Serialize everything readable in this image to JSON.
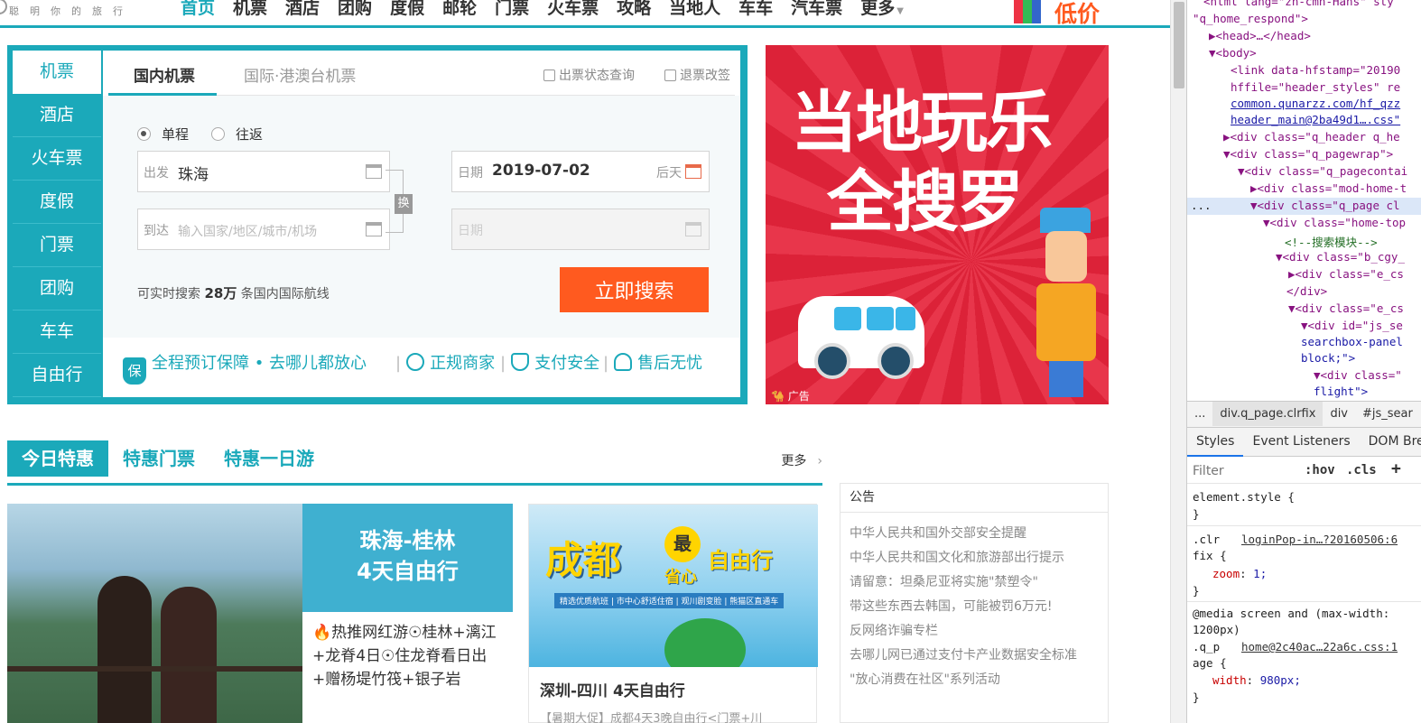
{
  "header": {
    "logo_tagline": "聪明你的旅行",
    "nav": [
      {
        "label": "首页",
        "active": true
      },
      {
        "label": "机票"
      },
      {
        "label": "酒店"
      },
      {
        "label": "团购"
      },
      {
        "label": "度假"
      },
      {
        "label": "邮轮"
      },
      {
        "label": "门票"
      },
      {
        "label": "火车票"
      },
      {
        "label": "攻略"
      },
      {
        "label": "当地人"
      },
      {
        "label": "车车"
      },
      {
        "label": "汽车票"
      },
      {
        "label": "更多"
      }
    ],
    "promo": "低价"
  },
  "search": {
    "categories": [
      "机票",
      "酒店",
      "火车票",
      "度假",
      "门票",
      "团购",
      "车车",
      "自由行"
    ],
    "tabs": [
      "国内机票",
      "国际·港澳台机票"
    ],
    "links": [
      "出票状态查询",
      "退票改签"
    ],
    "trip_types": [
      "单程",
      "往返"
    ],
    "from_label": "出发",
    "from_value": "珠海",
    "to_label": "到达",
    "to_placeholder": "输入国家/地区/城市/机场",
    "swap": "换",
    "date_label": "日期",
    "date_value": "2019-07-02",
    "date_hint": "后天",
    "return_label": "日期",
    "count_prefix": "可实时搜索",
    "count_num": "28万",
    "count_suffix": "条国内国际航线",
    "button": "立即搜索",
    "guarantees": [
      "全程预订保障 • 去哪儿都放心",
      "正规商家",
      "支付安全",
      "售后无忧"
    ],
    "shield_glyph": "保"
  },
  "ad": {
    "line1": "当地玩乐",
    "line2": "全搜罗",
    "tag": "广告"
  },
  "deals": {
    "tabs": [
      "今日特惠",
      "特惠门票",
      "特惠一日游"
    ],
    "more": "更多",
    "card1": {
      "title_line1": "珠海-桂林",
      "title_line2": "4天自由行",
      "desc": "🔥热推网红游☉桂林+漓江+龙脊4日☉住龙脊看日出+赠杨堤竹筏+银子岩"
    },
    "card2": {
      "banner_main": "成都",
      "banner_badge": "最",
      "banner_sub": "省心",
      "banner_free": "自由行",
      "banner_strip": "精选优质航班 | 市中心舒适住宿 | 观川剧变脸 | 熊猫区直通车",
      "title": "深圳-四川 4天自由行",
      "subtitle": "【暑期大促】成都4天3晚自由行<门票+川"
    }
  },
  "notice": {
    "title": "公告",
    "items": [
      "中华人民共和国外交部安全提醒",
      "中华人民共和国文化和旅游部出行提示",
      "请留意：坦桑尼亚将实施\"禁塑令\"",
      "带这些东西去韩国，可能被罚6万元!",
      "反网络诈骗专栏",
      "去哪儿网已通过支付卡产业数据安全标准",
      "\"放心消费在社区\"系列活动"
    ]
  },
  "devtools": {
    "dom_lines": [
      "<html lang=\"zh-cmn-Hans\" sty",
      "\"q_home_respond\">",
      "▶<head>…</head>",
      "▼<body>",
      "<link data-hfstamp=\"20190",
      "hffile=\"header_styles\" re",
      "common.qunarzz.com/hf_qzz",
      "header_main@2ba49d1….css\"",
      "▶<div class=\"q_header q_he",
      "▼<div class=\"q_pagewrap\">",
      "▼<div class=\"q_pagecontai",
      "▶<div class=\"mod-home-t",
      "▼<div class=\"q_page cl",
      "▼<div class=\"home-top",
      "<!--搜索模块-->",
      "▼<div class=\"b_cgy_",
      "▶<div class=\"e_cs",
      "</div>",
      "▼<div class=\"e_cs",
      "▼<div id=\"js_se",
      "searchbox-panel",
      "block;\">",
      "▼<div class=\"",
      "flight\">"
    ],
    "selected_marker": "...",
    "breadcrumbs": [
      "...",
      "div.q_page.clrfix",
      "div",
      "#js_sear"
    ],
    "panel_tabs": [
      "Styles",
      "Event Listeners",
      "DOM Bre"
    ],
    "filter_placeholder": "Filter",
    "filter_buttons": [
      ":hov",
      ".cls",
      "+"
    ],
    "styles": {
      "element_style": "element.style {",
      "brace_close": "}",
      "rule1_selector": ".clr",
      "rule1_selector2": "fix {",
      "rule1_source": "loginPop-in…?20160506:6",
      "rule1_prop": "zoom",
      "rule1_value": "1;",
      "rule2_media": "@media screen and (max-width:",
      "rule2_media2": "1200px)",
      "rule2_selector": ".q_p",
      "rule2_selector2": "age {",
      "rule2_source": "home@2c40ac…22a6c.css:1",
      "rule2_prop": "width",
      "rule2_value": "980px;"
    }
  },
  "colors": {
    "brand": "#1ba9ba",
    "cta": "#ff5a1f",
    "ad_bg": "#e0283e"
  }
}
